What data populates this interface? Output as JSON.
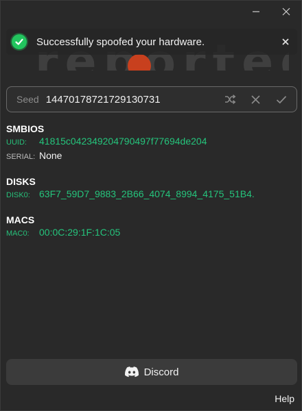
{
  "window": {
    "minimize_icon": "minimize-icon",
    "close_icon": "close-icon"
  },
  "logo": {
    "text": "reported"
  },
  "toast": {
    "message": "Successfully spoofed your hardware.",
    "icon": "check-circle-icon",
    "close_icon": "close-icon",
    "color": "#22c55e"
  },
  "seed": {
    "label": "Seed",
    "value": "14470178721729130731",
    "actions": [
      "shuffle-icon",
      "clear-icon",
      "confirm-icon"
    ]
  },
  "smbios": {
    "title": "SMBIOS",
    "uuid_key": "UUID:",
    "uuid_val": "41815c042349204790497f77694de204",
    "serial_key": "SERIAL:",
    "serial_val": "None"
  },
  "disks": {
    "title": "DISKS",
    "disk0_key": "DISK0:",
    "disk0_val": "63F7_59D7_9883_2B66_4074_8994_4175_51B4."
  },
  "macs": {
    "title": "MACS",
    "mac0_key": "MAC0:",
    "mac0_val": "00:0C:29:1F:1C:05"
  },
  "footer": {
    "discord_label": "Discord",
    "help_label": "Help"
  },
  "colors": {
    "accent_green": "#25c47c",
    "background": "#292929"
  }
}
